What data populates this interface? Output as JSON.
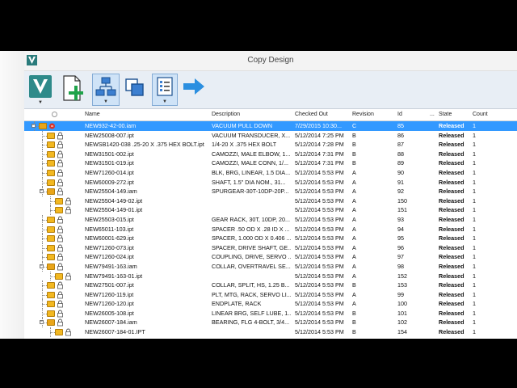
{
  "window": {
    "title": "Copy Design"
  },
  "toolbar": {
    "buttons": [
      {
        "name": "vault-menu-button",
        "icon": "vault-logo-icon"
      },
      {
        "name": "add-files-button",
        "icon": "add-document-icon"
      },
      {
        "name": "structure-view-button",
        "icon": "tree-structure-icon",
        "selected": true
      },
      {
        "name": "copy-view-button",
        "icon": "copy-icon"
      },
      {
        "name": "list-options-button",
        "icon": "list-icon",
        "selected": true
      },
      {
        "name": "next-button",
        "icon": "arrow-right-icon"
      }
    ]
  },
  "columns": {
    "name": "Name",
    "description": "Description",
    "checked_out": "Checked Out",
    "revision": "Revision",
    "id": "Id",
    "ellipsis": "...",
    "state": "State",
    "count": "Count"
  },
  "rows": [
    {
      "level": 0,
      "type": "asm",
      "expander": "−",
      "name": "NEW932-42-00.iam",
      "desc": "VACUUM PULL DOWN",
      "chk": "7/29/2015 10:30...",
      "rev": "C",
      "id": "85",
      "state": "Released",
      "count": "1",
      "selected": true
    },
    {
      "level": 1,
      "type": "part",
      "name": "NEW25008-007.ipt",
      "desc": "VACUUM TRANSDUCER, X...",
      "chk": "5/12/2014 7:25 PM",
      "rev": "B",
      "id": "86",
      "state": "Released",
      "count": "1"
    },
    {
      "level": 1,
      "type": "part",
      "name": "NEWSB1420-038 .25-20 X .375 HEX BOLT.ipt",
      "desc": "1/4-20 X .375 HEX BOLT",
      "chk": "5/12/2014 7:28 PM",
      "rev": "B",
      "id": "87",
      "state": "Released",
      "count": "1"
    },
    {
      "level": 1,
      "type": "part",
      "name": "NEW31501-002.ipt",
      "desc": "CAMOZZI, MALE ELBOW, 1...",
      "chk": "5/12/2014 7:31 PM",
      "rev": "B",
      "id": "88",
      "state": "Released",
      "count": "1"
    },
    {
      "level": 1,
      "type": "part",
      "name": "NEW31501-019.ipt",
      "desc": "CAMOZZI, MALE CONN, 1/...",
      "chk": "5/12/2014 7:31 PM",
      "rev": "B",
      "id": "89",
      "state": "Released",
      "count": "1"
    },
    {
      "level": 1,
      "type": "part",
      "name": "NEW71260-014.ipt",
      "desc": "BLK, BRG, LINEAR, 1.5 DIA...",
      "chk": "5/12/2014 5:53 PM",
      "rev": "A",
      "id": "90",
      "state": "Released",
      "count": "1"
    },
    {
      "level": 1,
      "type": "part",
      "name": "NEW60009-272.ipt",
      "desc": "SHAFT, 1.5\" DIA NOM., 31...",
      "chk": "5/12/2014 5:53 PM",
      "rev": "A",
      "id": "91",
      "state": "Released",
      "count": "1"
    },
    {
      "level": 1,
      "type": "asm",
      "expander": "−",
      "name": "NEW25504-149.iam",
      "desc": "SPURGEAR-30T-10DP-20P...",
      "chk": "5/12/2014 5:53 PM",
      "rev": "A",
      "id": "92",
      "state": "Released",
      "count": "1"
    },
    {
      "level": 2,
      "type": "part",
      "name": "NEW25504-149-02.ipt",
      "desc": "",
      "chk": "5/12/2014 5:53 PM",
      "rev": "A",
      "id": "150",
      "state": "Released",
      "count": "1"
    },
    {
      "level": 2,
      "type": "part",
      "name": "NEW25504-149-01.ipt",
      "desc": "",
      "chk": "5/12/2014 5:53 PM",
      "rev": "A",
      "id": "151",
      "state": "Released",
      "count": "1"
    },
    {
      "level": 1,
      "type": "part",
      "name": "NEW25503-015.ipt",
      "desc": "GEAR RACK, 30T, 10DP, 20...",
      "chk": "5/12/2014 5:53 PM",
      "rev": "A",
      "id": "93",
      "state": "Released",
      "count": "1"
    },
    {
      "level": 1,
      "type": "part",
      "name": "NEW65011-103.ipt",
      "desc": "SPACER .50 OD X .28 ID X ...",
      "chk": "5/12/2014 5:53 PM",
      "rev": "A",
      "id": "94",
      "state": "Released",
      "count": "1"
    },
    {
      "level": 1,
      "type": "part",
      "name": "NEW60001-629.ipt",
      "desc": "SPACER, 1.000 OD X 0.406 ...",
      "chk": "5/12/2014 5:53 PM",
      "rev": "A",
      "id": "95",
      "state": "Released",
      "count": "1"
    },
    {
      "level": 1,
      "type": "part",
      "name": "NEW71260-073.ipt",
      "desc": "SPACER, DRIVE SHAFT, GE...",
      "chk": "5/12/2014 5:53 PM",
      "rev": "A",
      "id": "96",
      "state": "Released",
      "count": "1"
    },
    {
      "level": 1,
      "type": "part",
      "name": "NEW71260-024.ipt",
      "desc": "COUPLING, DRIVE, SERVO ...",
      "chk": "5/12/2014 5:53 PM",
      "rev": "A",
      "id": "97",
      "state": "Released",
      "count": "1"
    },
    {
      "level": 1,
      "type": "asm",
      "expander": "−",
      "name": "NEW79491-163.iam",
      "desc": "COLLAR, OVERTRAVEL SE...",
      "chk": "5/12/2014 5:53 PM",
      "rev": "A",
      "id": "98",
      "state": "Released",
      "count": "1"
    },
    {
      "level": 2,
      "type": "part",
      "name": "NEW79491-163-01.ipt",
      "desc": "",
      "chk": "5/12/2014 5:53 PM",
      "rev": "A",
      "id": "152",
      "state": "Released",
      "count": "1"
    },
    {
      "level": 1,
      "type": "part",
      "name": "NEW27501-007.ipt",
      "desc": "COLLAR, SPLIT, HS, 1.25 B...",
      "chk": "5/12/2014 5:53 PM",
      "rev": "B",
      "id": "153",
      "state": "Released",
      "count": "1"
    },
    {
      "level": 1,
      "type": "part",
      "name": "NEW71260-119.ipt",
      "desc": "PLT, MTG, RACK, SERVO LI...",
      "chk": "5/12/2014 5:53 PM",
      "rev": "A",
      "id": "99",
      "state": "Released",
      "count": "1"
    },
    {
      "level": 1,
      "type": "part",
      "name": "NEW71260-120.ipt",
      "desc": "ENDPLATE, RACK",
      "chk": "5/12/2014 5:53 PM",
      "rev": "A",
      "id": "100",
      "state": "Released",
      "count": "1"
    },
    {
      "level": 1,
      "type": "part",
      "name": "NEW26005-108.ipt",
      "desc": "LINEAR BRG, SELF LUBE, 1...",
      "chk": "5/12/2014 5:53 PM",
      "rev": "B",
      "id": "101",
      "state": "Released",
      "count": "1"
    },
    {
      "level": 1,
      "type": "asm",
      "expander": "−",
      "name": "NEW26007-184.iam",
      "desc": "BEARING, FLG 4-BOLT, 3/4...",
      "chk": "5/12/2014 5:53 PM",
      "rev": "B",
      "id": "102",
      "state": "Released",
      "count": "1"
    },
    {
      "level": 2,
      "type": "part",
      "name": "NEW26007-184-01.IPT",
      "desc": "",
      "chk": "5/12/2014 5:53 PM",
      "rev": "B",
      "id": "154",
      "state": "Released",
      "count": "1"
    }
  ]
}
